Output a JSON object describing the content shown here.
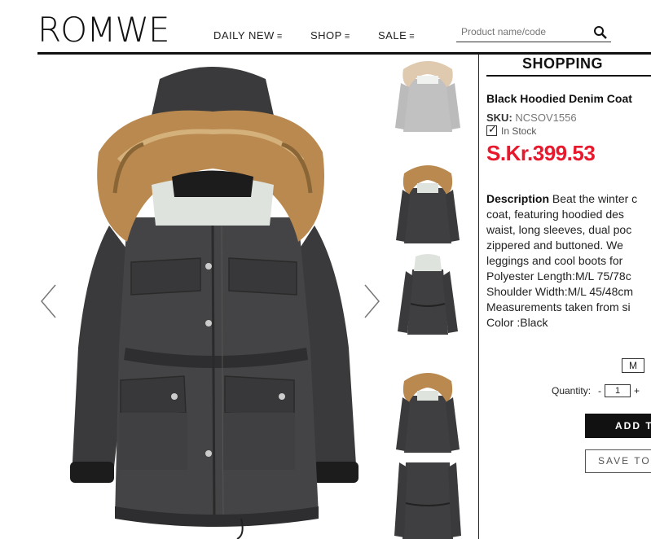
{
  "header": {
    "logo": "ROMWE",
    "nav": [
      {
        "label": "DAILY NEW"
      },
      {
        "label": "SHOP"
      },
      {
        "label": "SALE"
      }
    ],
    "search_placeholder": "Product name/code"
  },
  "panel": {
    "title": "SHOPPING",
    "product_name": "Black Hoodied Denim Coat",
    "sku_label": "SKU:",
    "sku_value": "NCSOV1556",
    "stock": "In Stock",
    "price": "S.Kr.399.53",
    "description_label": "Description",
    "description_lines": [
      "Beat the winter c",
      "coat, featuring hoodied des",
      "waist, long sleeves, dual poc",
      "zippered and buttoned. We",
      "leggings and cool boots for",
      "Polyester Length:M/L 75/78c",
      "Shoulder Width:M/L 45/48cm",
      "Measurements taken from si",
      "Color :Black"
    ],
    "size": "M",
    "quantity_label": "Quantity:",
    "quantity_minus": "-",
    "quantity_value": "1",
    "quantity_plus": "+",
    "add_button": "ADD TO",
    "save_button": "SAVE TO W"
  },
  "colors": {
    "price": "#e8192c",
    "coat": "#3a3a3c",
    "fur": "#b9894f"
  },
  "icons": {
    "search": "search-icon",
    "prev": "chevron-left-icon",
    "next": "chevron-right-icon"
  }
}
